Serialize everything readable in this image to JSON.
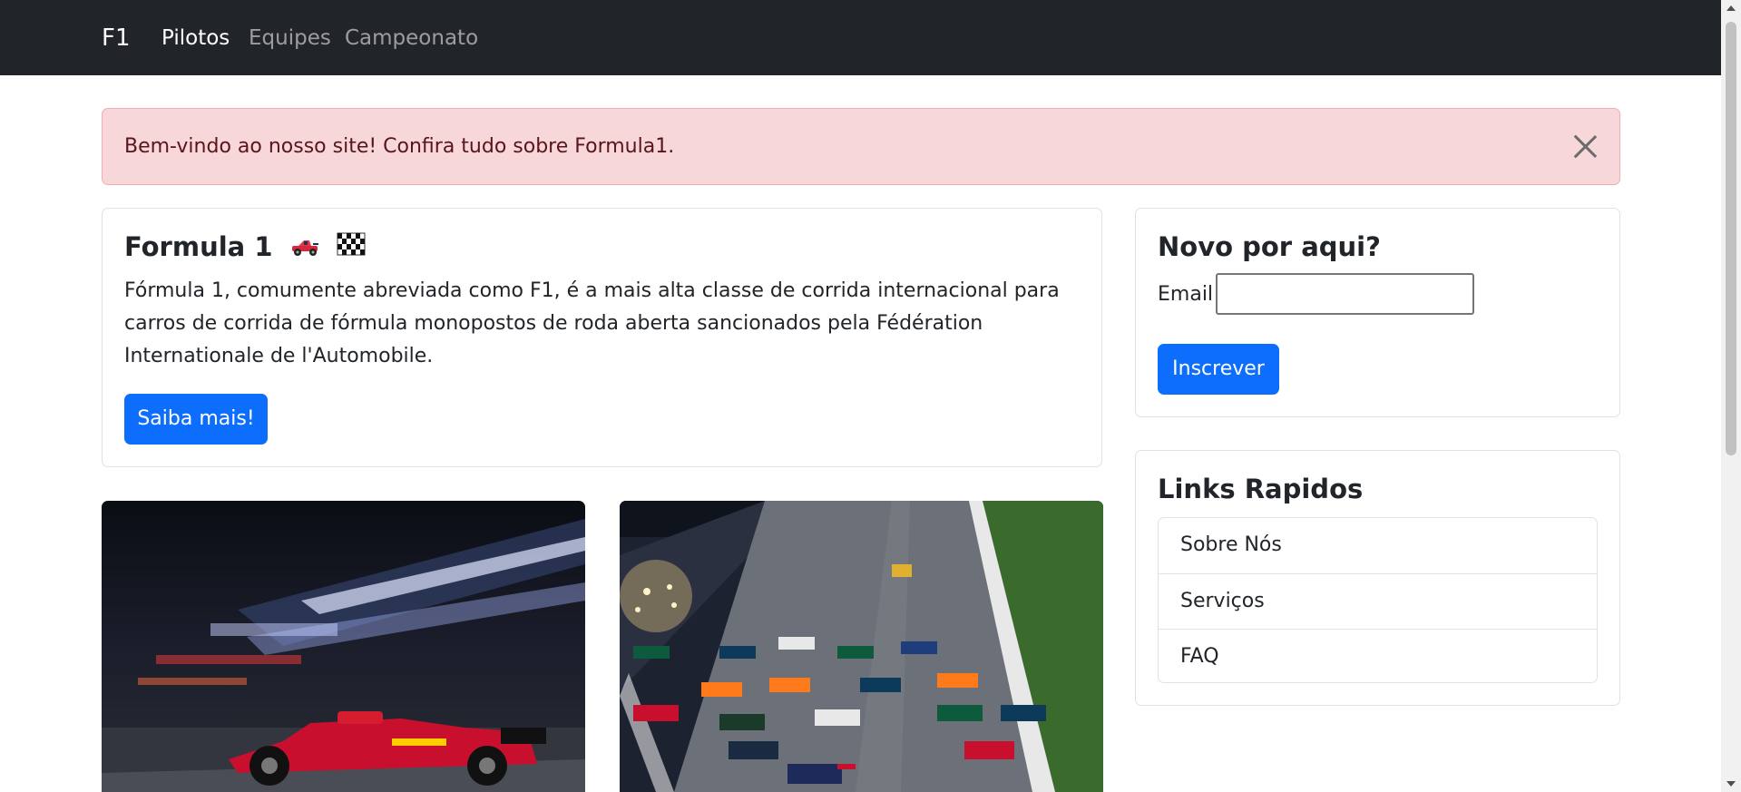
{
  "navbar": {
    "brand": "F1",
    "links": [
      {
        "label": "Pilotos",
        "active": true
      },
      {
        "label": "Equipes",
        "active": false
      },
      {
        "label": "Campeonato",
        "active": false
      }
    ]
  },
  "alert": {
    "message": "Bem-vindo ao nosso site! Confira tudo sobre Formula1.",
    "close_icon": "close-icon"
  },
  "intro": {
    "title": "Formula 1",
    "emojis": [
      "racing-car-icon",
      "checkered-flag-icon"
    ],
    "text": "Fórmula 1, comumente abreviada como F1, é a mais alta classe de corrida internacional para carros de corrida de fórmula monopostos de roda aberta sancionados pela Fédération Internationale de l'Automobile.",
    "button_label": "Saiba mais!"
  },
  "newsletter": {
    "title": "Novo por aqui?",
    "email_label": "Email",
    "email_value": "",
    "button_label": "Inscrever"
  },
  "quick_links": {
    "title": "Links Rapidos",
    "items": [
      "Sobre Nós",
      "Serviços",
      "FAQ"
    ]
  },
  "images": [
    {
      "subject": "red-f1-car-night-motion-blur"
    },
    {
      "subject": "f1-race-start-grid"
    }
  ],
  "colors": {
    "navbar_bg": "#212529",
    "primary": "#0d6efd",
    "alert_bg": "#f8d7da",
    "alert_text": "#58151c"
  }
}
